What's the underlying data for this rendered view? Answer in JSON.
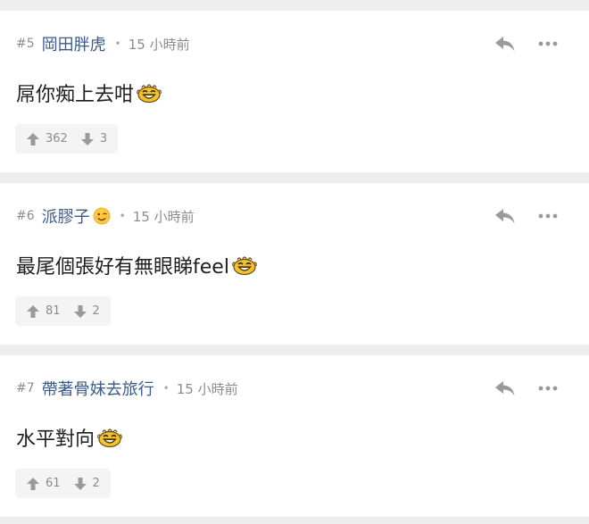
{
  "colors": {
    "background": "#eeeeee",
    "card": "#ffffff",
    "username": "#3b5a8a",
    "muted": "#8c8c8c",
    "content": "#1e1e1e",
    "vote_bg": "#f4f4f4"
  },
  "posts": [
    {
      "floor": "#5",
      "username": "岡田胖虎",
      "separator": "•",
      "time": "15 小時前",
      "content": "屌你痴上去咁",
      "content_emoji": "laugh-sticker-icon",
      "upvotes": "362",
      "downvotes": "3"
    },
    {
      "floor": "#6",
      "username": "派膠子",
      "username_emoji": "wink-emoji-icon",
      "separator": "•",
      "time": "15 小時前",
      "content": "最尾個張好有無眼睇feel",
      "content_emoji": "laugh-sticker-icon",
      "upvotes": "81",
      "downvotes": "2"
    },
    {
      "floor": "#7",
      "username": "帶著骨妹去旅行",
      "separator": "•",
      "time": "15 小時前",
      "content": "水平對向 ",
      "content_emoji": "laugh-sticker-icon",
      "upvotes": "61",
      "downvotes": "2"
    }
  ]
}
